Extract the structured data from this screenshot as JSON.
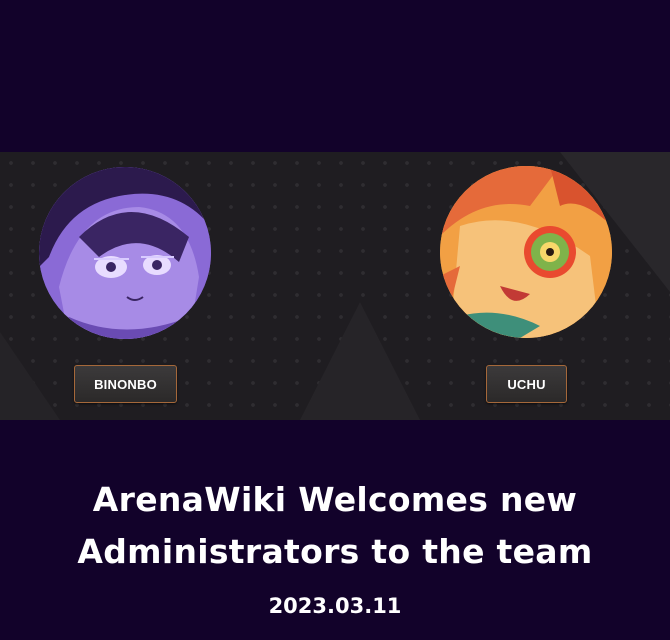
{
  "banner": {
    "left_admin": {
      "name": "BINONBO",
      "avatar_color": "#8566d0"
    },
    "right_admin": {
      "name": "UCHU",
      "avatar_color": "#f29a3e"
    },
    "button_border_color": "#a5683a"
  },
  "headline": {
    "line1": "ArenaWiki Welcomes new",
    "line2": "Administrators to the team"
  },
  "date": "2023.03.11",
  "colors": {
    "background": "#12022a",
    "banner": "#1f1d21",
    "text": "#ffffff"
  }
}
